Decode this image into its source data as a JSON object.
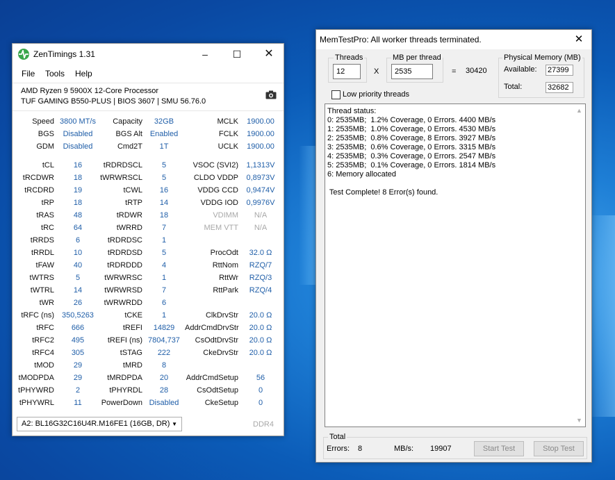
{
  "zentimings": {
    "title": "ZenTimings 1.31",
    "menu": [
      "File",
      "Tools",
      "Help"
    ],
    "cpu": "AMD Ryzen 9 5900X 12-Core Processor",
    "board": "TUF GAMING B550-PLUS | BIOS 3607 | SMU 56.76.0",
    "top": [
      [
        "Speed",
        "3800 MT/s",
        "Capacity",
        "32GB",
        "MCLK",
        "1900.00"
      ],
      [
        "BGS",
        "Disabled",
        "BGS Alt",
        "Enabled",
        "FCLK",
        "1900.00"
      ],
      [
        "GDM",
        "Disabled",
        "Cmd2T",
        "1T",
        "UCLK",
        "1900.00"
      ]
    ],
    "rows": [
      [
        "tCL",
        "16",
        "tRDRDSCL",
        "5",
        "VSOC (SVI2)",
        "1,1313V"
      ],
      [
        "tRCDWR",
        "18",
        "tWRWRSCL",
        "5",
        "CLDO VDDP",
        "0,8973V"
      ],
      [
        "tRCDRD",
        "19",
        "tCWL",
        "16",
        "VDDG CCD",
        "0,9474V"
      ],
      [
        "tRP",
        "18",
        "tRTP",
        "14",
        "VDDG IOD",
        "0,9976V"
      ],
      [
        "tRAS",
        "48",
        "tRDWR",
        "18",
        "VDIMM",
        "N/A"
      ],
      [
        "tRC",
        "64",
        "tWRRD",
        "7",
        "MEM VTT",
        "N/A"
      ],
      [
        "tRRDS",
        "6",
        "tRDRDSC",
        "1",
        "",
        ""
      ],
      [
        "tRRDL",
        "10",
        "tRDRDSD",
        "5",
        "ProcOdt",
        "32.0 Ω"
      ],
      [
        "tFAW",
        "40",
        "tRDRDDD",
        "4",
        "RttNom",
        "RZQ/7"
      ],
      [
        "tWTRS",
        "5",
        "tWRWRSC",
        "1",
        "RttWr",
        "RZQ/3"
      ],
      [
        "tWTRL",
        "14",
        "tWRWRSD",
        "7",
        "RttPark",
        "RZQ/4"
      ],
      [
        "tWR",
        "26",
        "tWRWRDD",
        "6",
        "",
        ""
      ],
      [
        "tRFC (ns)",
        "350,5263",
        "tCKE",
        "1",
        "ClkDrvStr",
        "20.0 Ω"
      ],
      [
        "tRFC",
        "666",
        "tREFI",
        "14829",
        "AddrCmdDrvStr",
        "20.0 Ω"
      ],
      [
        "tRFC2",
        "495",
        "tREFI (ns)",
        "7804,737",
        "CsOdtDrvStr",
        "20.0 Ω"
      ],
      [
        "tRFC4",
        "305",
        "tSTAG",
        "222",
        "CkeDrvStr",
        "20.0 Ω"
      ],
      [
        "tMOD",
        "29",
        "tMRD",
        "8",
        "",
        ""
      ],
      [
        "tMODPDA",
        "29",
        "tMRDPDA",
        "20",
        "AddrCmdSetup",
        "56"
      ],
      [
        "tPHYWRD",
        "2",
        "tPHYRDL",
        "28",
        "CsOdtSetup",
        "0"
      ],
      [
        "tPHYWRL",
        "11",
        "PowerDown",
        "Disabled",
        "CkeSetup",
        "0"
      ]
    ],
    "dimm": "A2: BL16G32C16U4R.M16FE1 (16GB, DR)",
    "ddr": "DDR4"
  },
  "memtest": {
    "title": "MemTestPro: All worker threads terminated.",
    "threads_label": "Threads",
    "threads_value": "12",
    "mb_label": "MB per thread",
    "mb_value": "2535",
    "times": "X",
    "equals": "=",
    "total_mb": "30420",
    "phys_label": "Physical Memory (MB)",
    "available_label": "Available:",
    "available_value": "27399",
    "total_label": "Total:",
    "total_value": "32682",
    "low_priority": "Low priority threads",
    "status_lines": [
      "Thread status:",
      "0: 2535MB;  1.2% Coverage, 0 Errors. 4400 MB/s",
      "1: 2535MB;  1.0% Coverage, 0 Errors. 4530 MB/s",
      "2: 2535MB;  0.8% Coverage, 8 Errors. 3927 MB/s",
      "3: 2535MB;  0.6% Coverage, 0 Errors. 3315 MB/s",
      "4: 2535MB;  0.3% Coverage, 0 Errors. 2547 MB/s",
      "5: 2535MB;  0.1% Coverage, 0 Errors. 1814 MB/s",
      "6: Memory allocated",
      "",
      " Test Complete! 8 Error(s) found."
    ],
    "total_group": "Total",
    "errors_label": "Errors:",
    "errors_value": "8",
    "mbs_label": "MB/s:",
    "mbs_value": "19907",
    "start_btn": "Start Test",
    "stop_btn": "Stop Test"
  }
}
